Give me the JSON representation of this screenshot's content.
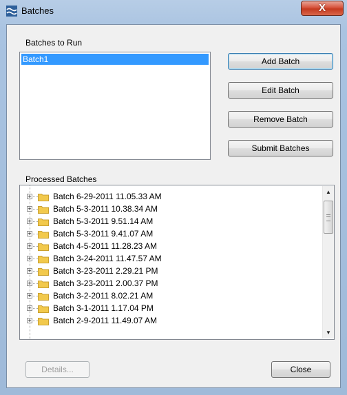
{
  "window": {
    "title": "Batches",
    "close_glyph": "X",
    "icon": "wave-icon"
  },
  "run_section": {
    "label": "Batches to Run",
    "items": [
      "Batch1"
    ],
    "selected_index": 0
  },
  "buttons": {
    "add_batch": "Add Batch",
    "edit_batch": "Edit Batch",
    "remove_batch": "Remove Batch",
    "submit_batches": "Submit Batches",
    "details": "Details...",
    "close": "Close"
  },
  "processed_section": {
    "label": "Processed Batches",
    "items": [
      "Batch 6-29-2011 11.05.33 AM",
      "Batch 5-3-2011 10.38.34 AM",
      "Batch 5-3-2011 9.51.14 AM",
      "Batch 5-3-2011 9.41.07 AM",
      "Batch 4-5-2011 11.28.23 AM",
      "Batch 3-24-2011 11.47.57 AM",
      "Batch 3-23-2011 2.29.21 PM",
      "Batch 3-23-2011 2.00.37 PM",
      "Batch 3-2-2011 8.02.21 AM",
      "Batch 3-1-2011 1.17.04 PM",
      "Batch 2-9-2011 11.49.07 AM"
    ],
    "expander_glyph": "+",
    "scroll_up_glyph": "▲",
    "scroll_down_glyph": "▼"
  },
  "colors": {
    "selection": "#3399ff",
    "folder": "#f2c94c",
    "close_button": "#c9452a"
  }
}
